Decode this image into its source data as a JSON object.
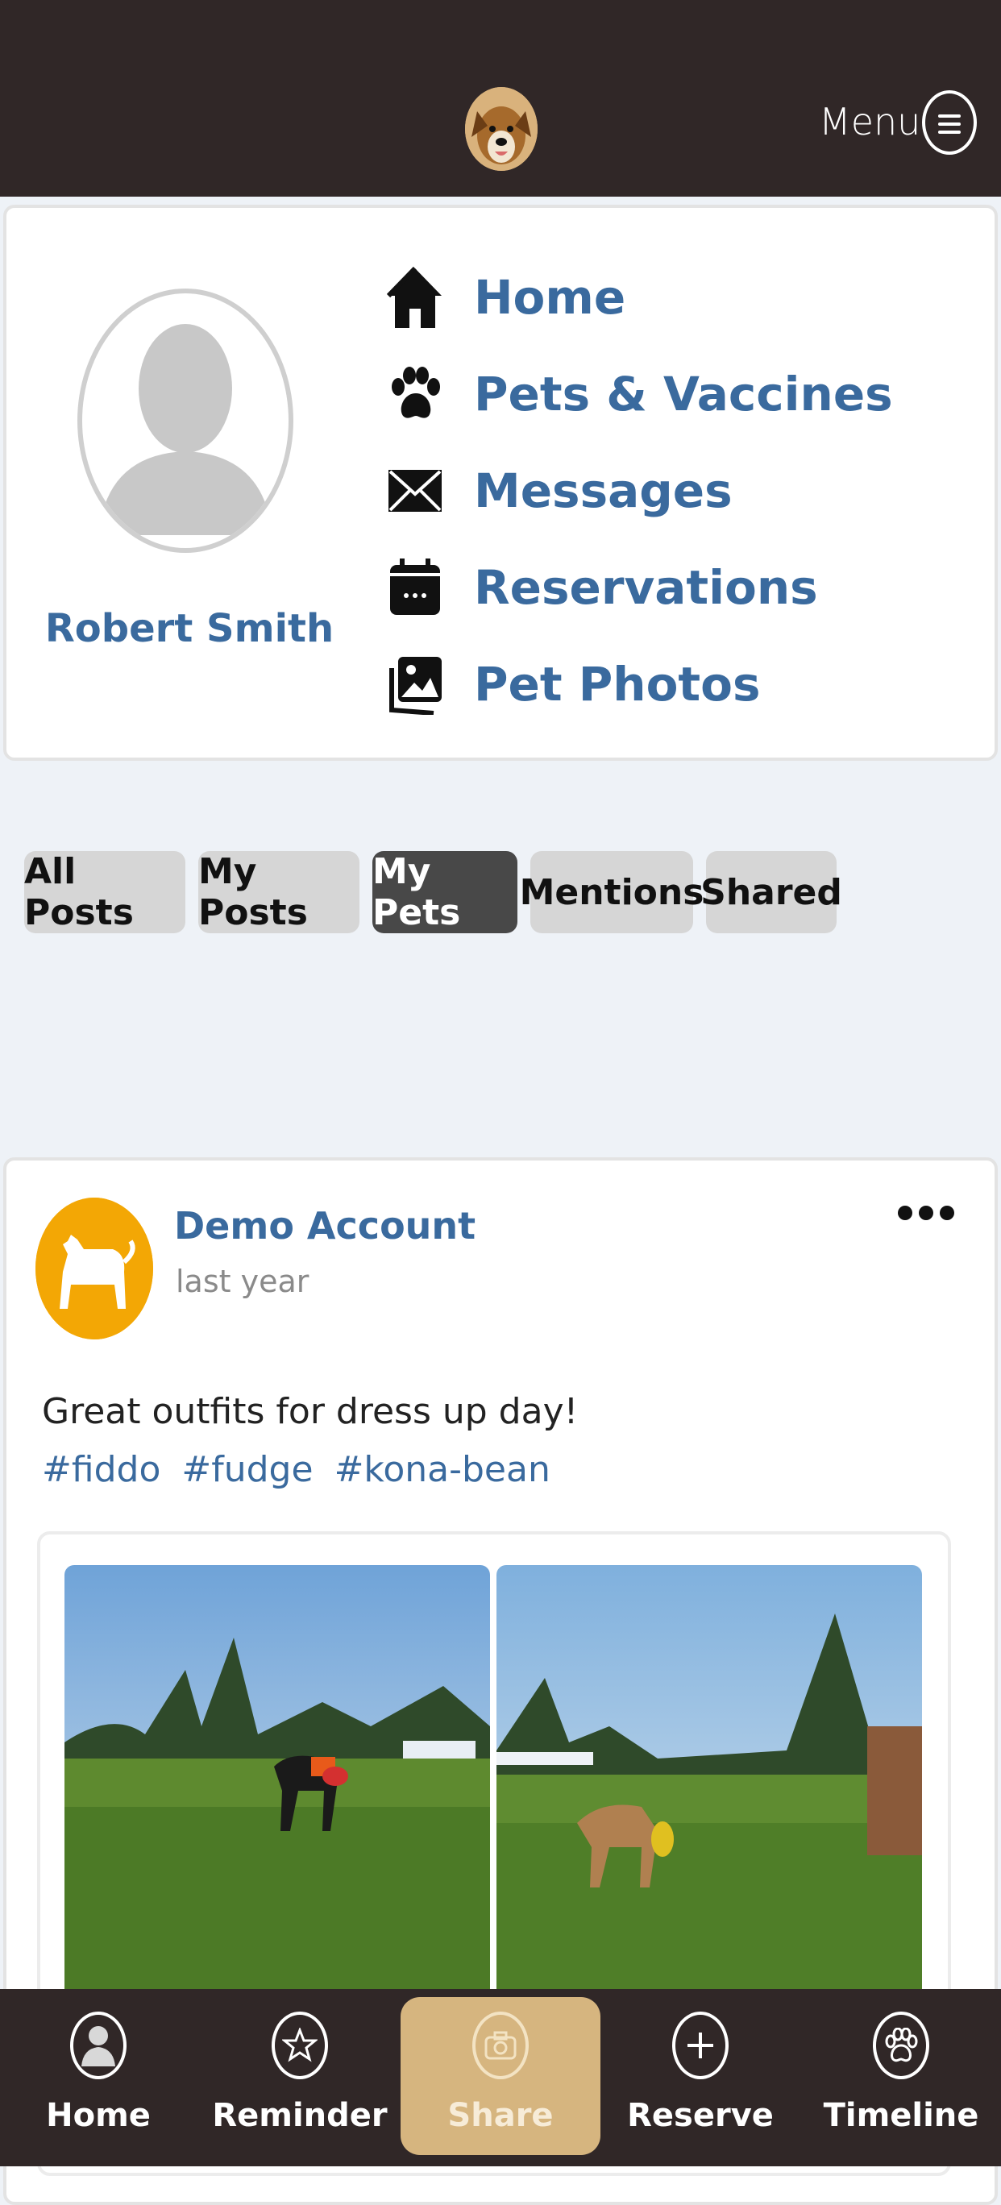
{
  "header": {
    "menu_label": "Menu"
  },
  "profile": {
    "name": "Robert Smith",
    "nav": [
      {
        "label": "Home",
        "icon": "home-icon"
      },
      {
        "label": "Pets & Vaccines",
        "icon": "paw-icon"
      },
      {
        "label": "Messages",
        "icon": "envelope-icon"
      },
      {
        "label": "Reservations",
        "icon": "calendar-icon"
      },
      {
        "label": "Pet Photos",
        "icon": "photos-icon"
      }
    ]
  },
  "filters": {
    "tabs": [
      "All Posts",
      "My Posts",
      "My Pets",
      "Mentions",
      "Shared"
    ],
    "active": "My Pets"
  },
  "post": {
    "author": "Demo Account",
    "time": "last year",
    "text": "Great outfits for dress up day!",
    "tags": [
      "#fiddo",
      "#fudge",
      "#kona-bean"
    ]
  },
  "bottom_nav": {
    "items": [
      "Home",
      "Reminder",
      "Share",
      "Reserve",
      "Timeline"
    ]
  },
  "colors": {
    "header_bg": "#302727",
    "accent_blue": "#3a6a9e",
    "share_gold": "#d6b57f",
    "post_avatar_orange": "#f3a705"
  }
}
